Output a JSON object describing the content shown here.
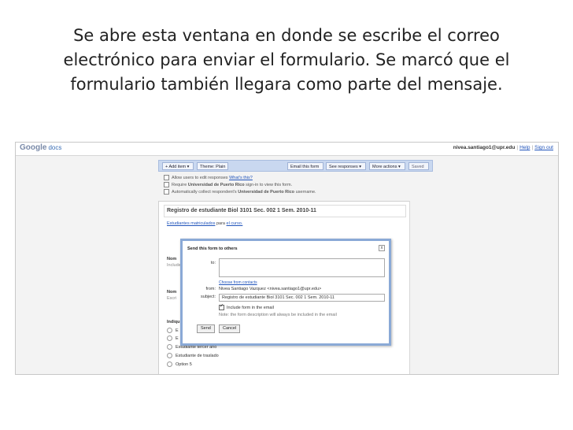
{
  "caption": {
    "line1": "Se abre esta ventana en donde se escribe el correo",
    "line2": "electrónico para enviar el formulario. Se marcó que el",
    "line3": "formulario también llegara como parte del mensaje."
  },
  "app": {
    "logo": "Google",
    "logo_sub": "docs",
    "user_email": "nivea.santiago1@upr.edu",
    "help": "Help",
    "sign_out": "Sign out"
  },
  "toolbar": {
    "add_item": "Add item",
    "theme": "Theme: Plain",
    "email_form": "Email this form",
    "see_responses": "See responses",
    "more_actions": "More actions",
    "saved": "Saved"
  },
  "options": {
    "allow_edit": "Allow users to edit responses",
    "whats_this": "What's this?",
    "require_signin_pre": "Require",
    "require_signin_org": "Universidad de Puerto Rico",
    "require_signin_post": "sign-in to view this form.",
    "collect_pre": "Automatically collect respondent's",
    "collect_org": "Universidad de Puerto Rico",
    "collect_post": "username."
  },
  "form": {
    "title": "Registro de estudiante Biol 3101 Sec. 002 1 Sem. 2010-11",
    "desc_link": "Estudiantes matriculados",
    "desc_mid": "para",
    "desc_link2": "el curso.",
    "q1": "Nom",
    "q1_help": "Include",
    "q2": "Nom",
    "q2_help": "Escri",
    "q3": "Indiqu",
    "options": [
      "E",
      "E",
      "Estudiante tercer año",
      "Estudiante de traslado",
      "Option 5"
    ]
  },
  "dialog": {
    "title": "Send this form to others",
    "close": "x",
    "to_label": "to:",
    "choose_contacts": "Choose from contacts",
    "from_label": "from:",
    "from_value": "Nivea Santiago Vazquez <nivea.santiago1@upr.edu>",
    "subject_label": "subject:",
    "subject_value": "Registro de estudiante Biol 3101 Sec. 002 1 Sem. 2010-11",
    "include_form": "Include form in the email",
    "note": "Note: the form description will always be included in the email",
    "send": "Send",
    "cancel": "Cancel"
  }
}
